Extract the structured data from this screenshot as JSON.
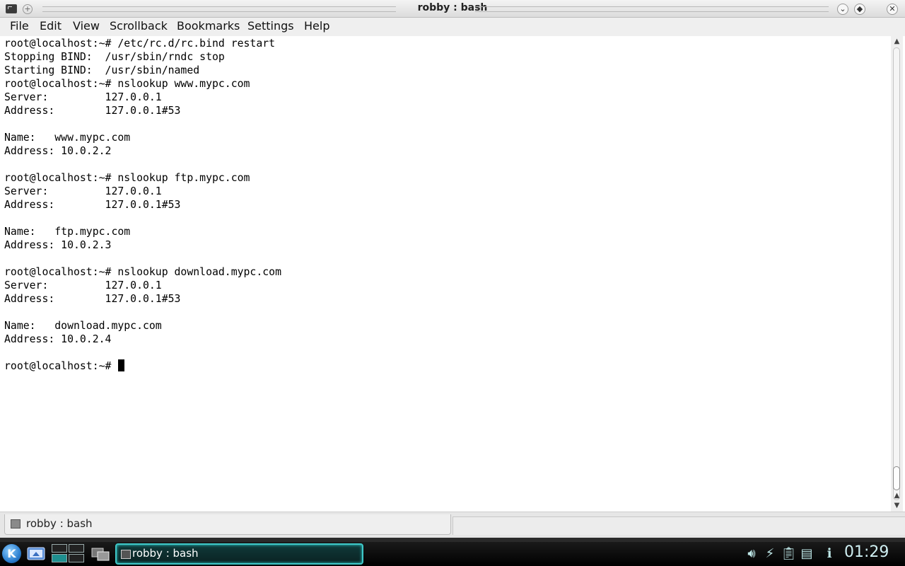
{
  "window": {
    "title": "robby : bash"
  },
  "menubar": {
    "items": [
      "File",
      "Edit",
      "View",
      "Scrollback",
      "Bookmarks",
      "Settings",
      "Help"
    ]
  },
  "terminal": {
    "lines": [
      "root@localhost:~# /etc/rc.d/rc.bind restart",
      "Stopping BIND:  /usr/sbin/rndc stop",
      "Starting BIND:  /usr/sbin/named",
      "root@localhost:~# nslookup www.mypc.com",
      "Server:         127.0.0.1",
      "Address:        127.0.0.1#53",
      "",
      "Name:   www.mypc.com",
      "Address: 10.0.2.2",
      "",
      "root@localhost:~# nslookup ftp.mypc.com",
      "Server:         127.0.0.1",
      "Address:        127.0.0.1#53",
      "",
      "Name:   ftp.mypc.com",
      "Address: 10.0.2.3",
      "",
      "root@localhost:~# nslookup download.mypc.com",
      "Server:         127.0.0.1",
      "Address:        127.0.0.1#53",
      "",
      "Name:   download.mypc.com",
      "Address: 10.0.2.4",
      ""
    ],
    "prompt": "root@localhost:~# "
  },
  "tabs": [
    {
      "label": "robby : bash",
      "icon": "terminal-icon"
    }
  ],
  "taskbar": {
    "task_label": "robby : bash",
    "clock": "01:29",
    "tray_icons": [
      "volume-icon",
      "battery-icon",
      "clipboard-icon",
      "network-icon",
      "notifications-icon"
    ]
  },
  "colors": {
    "panel_accent": "#3fc8c8",
    "terminal_bg": "#ffffff",
    "terminal_fg": "#000000"
  }
}
